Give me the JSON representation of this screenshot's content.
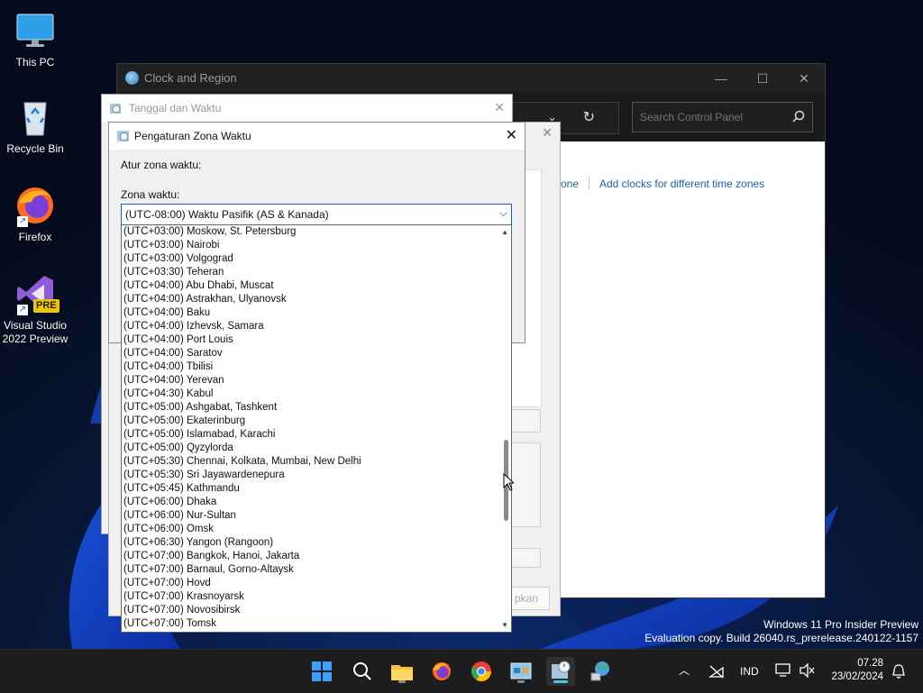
{
  "desktop": {
    "icons": [
      {
        "label": "This PC",
        "icon": "monitor-icon"
      },
      {
        "label": "Recycle Bin",
        "icon": "recycle-bin-icon"
      },
      {
        "label": "Firefox",
        "icon": "firefox-icon"
      },
      {
        "label_line1": "Visual Studio",
        "label_line2": "2022 Preview",
        "badge": "PRE",
        "icon": "visual-studio-icon"
      }
    ]
  },
  "control_panel": {
    "title": "Clock and Region",
    "search_placeholder": "Search Control Panel",
    "link_partial": "one",
    "link_add_clocks": "Add clocks for different time zones"
  },
  "date_time_dialog": {
    "title": "Tanggal dan Waktu",
    "button_partial": "pkan"
  },
  "timezone_dialog": {
    "title": "Pengaturan Zona Waktu",
    "set_label": "Atur zona waktu:",
    "zone_label": "Zona waktu:",
    "selected": "(UTC-08:00) Waktu Pasifik (AS & Kanada)",
    "options": [
      "(UTC+03:00) Moskow, St. Petersburg",
      "(UTC+03:00) Nairobi",
      "(UTC+03:00) Volgograd",
      "(UTC+03:30) Teheran",
      "(UTC+04:00) Abu Dhabi, Muscat",
      "(UTC+04:00) Astrakhan, Ulyanovsk",
      "(UTC+04:00) Baku",
      "(UTC+04:00) Izhevsk, Samara",
      "(UTC+04:00) Port Louis",
      "(UTC+04:00) Saratov",
      "(UTC+04:00) Tbilisi",
      "(UTC+04:00) Yerevan",
      "(UTC+04:30) Kabul",
      "(UTC+05:00) Ashgabat, Tashkent",
      "(UTC+05:00) Ekaterinburg",
      "(UTC+05:00) Islamabad, Karachi",
      "(UTC+05:00) Qyzylorda",
      "(UTC+05:30) Chennai, Kolkata, Mumbai, New Delhi",
      "(UTC+05:30) Sri Jayawardenepura",
      "(UTC+05:45) Kathmandu",
      "(UTC+06:00) Dhaka",
      "(UTC+06:00) Nur-Sultan",
      "(UTC+06:00) Omsk",
      "(UTC+06:30) Yangon (Rangoon)",
      "(UTC+07:00) Bangkok, Hanoi, Jakarta",
      "(UTC+07:00) Barnaul, Gorno-Altaysk",
      "(UTC+07:00) Hovd",
      "(UTC+07:00) Krasnoyarsk",
      "(UTC+07:00) Novosibirsk",
      "(UTC+07:00) Tomsk"
    ]
  },
  "watermark": {
    "line1": "Windows 11 Pro Insider Preview",
    "line2": "Evaluation copy. Build 26040.rs_prerelease.240122-1157"
  },
  "taskbar": {
    "apps": [
      "start-icon",
      "search-icon",
      "file-explorer-icon",
      "firefox-icon",
      "chrome-icon",
      "control-panel-icon",
      "date-time-icon",
      "network-globe-icon"
    ],
    "language": "IND",
    "time": "07.28",
    "date": "23/02/2024",
    "accent": "#4cc2ff"
  }
}
